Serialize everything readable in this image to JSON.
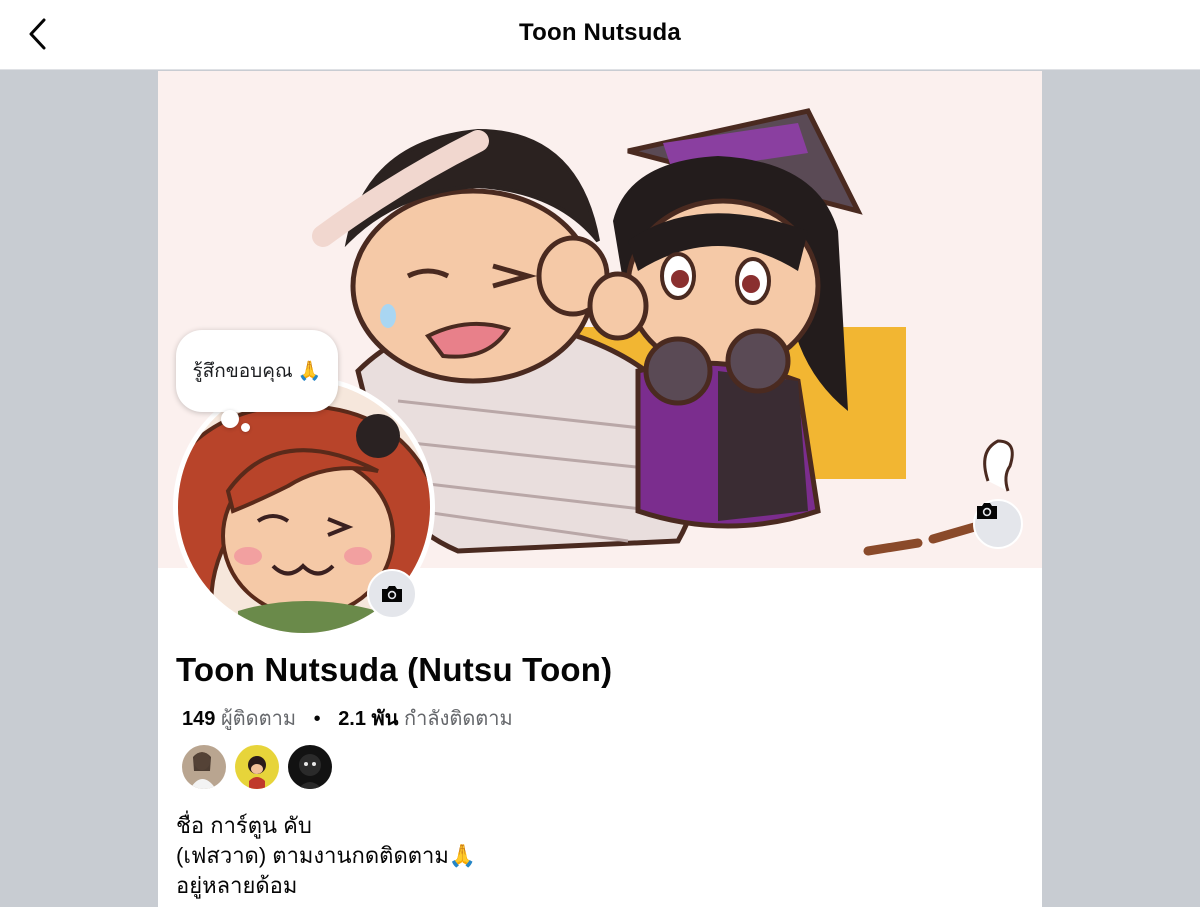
{
  "header": {
    "title": "Toon Nutsuda",
    "back_icon": "chevron-left-icon"
  },
  "cover": {
    "camera_icon": "camera-icon",
    "background_color": "#fbf0ee",
    "accent_yellow": "#f2b632",
    "accent_purple": "#7b2d8e"
  },
  "avatar": {
    "thought_bubble": "รู้สึกขอบคุณ 🙏",
    "camera_icon": "camera-icon"
  },
  "profile": {
    "name": "Toon Nutsuda (Nutsu Toon)",
    "followers_count": "149",
    "followers_label": "ผู้ติดตาม",
    "separator": "•",
    "following_count": "2.1 พัน",
    "following_label": "กำลังติดตาม"
  },
  "friends": [
    "friend-avatar-1",
    "friend-avatar-2",
    "friend-avatar-3"
  ],
  "bio": {
    "line1": "ชื่อ การ์ตูน คับ",
    "line2": "(เฟสวาด) ตามงานกดติดตาม🙏",
    "line3": "อยู่หลายด้อม"
  }
}
